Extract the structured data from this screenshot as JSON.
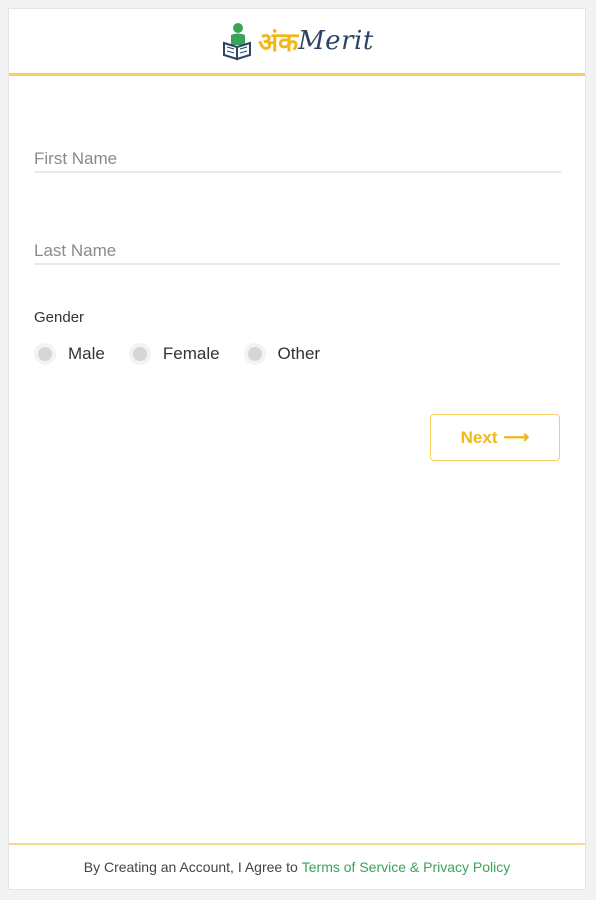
{
  "header": {
    "logo_hindi": "अंक",
    "logo_latin": "Merit",
    "logo_icon": "reader-book-icon"
  },
  "form": {
    "first_name_placeholder": "First Name",
    "last_name_placeholder": "Last Name",
    "gender_label": "Gender",
    "gender_options": [
      "Male",
      "Female",
      "Other"
    ],
    "next_label": "Next",
    "next_icon": "arrow-right-icon"
  },
  "footer": {
    "text": "By Creating an Account, I Agree to",
    "link_text": "Terms of Service & Privacy Policy"
  },
  "colors": {
    "accent": "#f0b817",
    "accent_border": "#f7cf63",
    "link": "#3aa357",
    "logo_navy": "#2c4463"
  }
}
